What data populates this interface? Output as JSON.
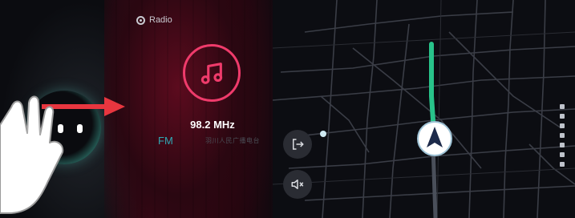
{
  "radio": {
    "title": "Radio",
    "frequency": "98.2 MHz",
    "band": "FM",
    "station_name": "羽川人民广播电台"
  },
  "map": {
    "route_color": "#28c38a"
  },
  "colors": {
    "accent_pink": "#ef3b6b",
    "band_teal": "#2fa7b3",
    "arrow_red": "#e8363f"
  },
  "icons": {
    "music": "music-note-icon",
    "exit": "exit-icon",
    "mute": "mute-icon",
    "radio": "radio-icon",
    "navigation": "navigation-arrow-icon",
    "home": "home-button-icon"
  }
}
